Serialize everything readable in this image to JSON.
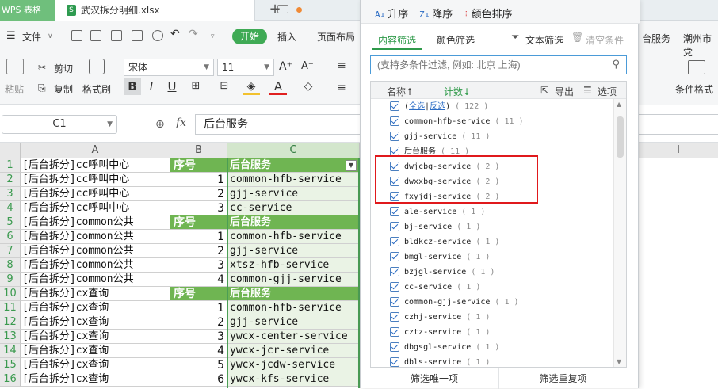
{
  "titlebar": {
    "app_tab": "WPS 表格",
    "file_tab": "武汉拆分明细.xlsx",
    "file_icon": "S",
    "new_tab": "+"
  },
  "menu": {
    "file": "文件",
    "start": "开始",
    "insert": "插入",
    "page_layout": "页面布局",
    "backend": "台服务",
    "chaozhou": "潮州市党"
  },
  "toolbar": {
    "paste": "粘贴",
    "cut": "剪切",
    "copy": "复制",
    "format_painter": "格式刷",
    "font": "宋体",
    "font_size": "11",
    "cond_format": "条件格式"
  },
  "formula_bar": {
    "name_box": "C1",
    "fx": "fx",
    "value": "后台服务"
  },
  "sheet": {
    "col_headers": [
      "A",
      "B",
      "C",
      "I"
    ],
    "rows": [
      {
        "n": "1",
        "a": "[后台拆分]cc呼叫中心",
        "b": "序号",
        "c": "后台服务",
        "hdr": true
      },
      {
        "n": "2",
        "a": "[后台拆分]cc呼叫中心",
        "b": "1",
        "c": "common-hfb-service",
        "hdr": false
      },
      {
        "n": "3",
        "a": "[后台拆分]cc呼叫中心",
        "b": "2",
        "c": "gjj-service",
        "hdr": false
      },
      {
        "n": "4",
        "a": "[后台拆分]cc呼叫中心",
        "b": "3",
        "c": "cc-service",
        "hdr": false
      },
      {
        "n": "5",
        "a": "[后台拆分]common公共",
        "b": "序号",
        "c": "后台服务",
        "hdr": true
      },
      {
        "n": "6",
        "a": "[后台拆分]common公共",
        "b": "1",
        "c": "common-hfb-service",
        "hdr": false
      },
      {
        "n": "7",
        "a": "[后台拆分]common公共",
        "b": "2",
        "c": "gjj-service",
        "hdr": false
      },
      {
        "n": "8",
        "a": "[后台拆分]common公共",
        "b": "3",
        "c": "xtsz-hfb-service",
        "hdr": false
      },
      {
        "n": "9",
        "a": "[后台拆分]common公共",
        "b": "4",
        "c": "common-gjj-service",
        "hdr": false
      },
      {
        "n": "10",
        "a": "[后台拆分]cx查询",
        "b": "序号",
        "c": "后台服务",
        "hdr": true
      },
      {
        "n": "11",
        "a": "[后台拆分]cx查询",
        "b": "1",
        "c": "common-hfb-service",
        "hdr": false
      },
      {
        "n": "12",
        "a": "[后台拆分]cx查询",
        "b": "2",
        "c": "gjj-service",
        "hdr": false
      },
      {
        "n": "13",
        "a": "[后台拆分]cx查询",
        "b": "3",
        "c": "ywcx-center-service",
        "hdr": false
      },
      {
        "n": "14",
        "a": "[后台拆分]cx查询",
        "b": "4",
        "c": "ywcx-jcr-service",
        "hdr": false
      },
      {
        "n": "15",
        "a": "[后台拆分]cx查询",
        "b": "5",
        "c": "ywcx-jcdw-service",
        "hdr": false
      },
      {
        "n": "16",
        "a": "[后台拆分]cx查询",
        "b": "6",
        "c": "ywcx-kfs-service",
        "hdr": false
      }
    ]
  },
  "filter": {
    "sort_asc": "升序",
    "sort_desc": "降序",
    "sort_color": "颜色排序",
    "tab_content": "内容筛选",
    "tab_color": "颜色筛选",
    "text_filter": "文本筛选",
    "clear": "清空条件",
    "search_placeholder": "(支持多条件过滤, 例如: 北京 上海)",
    "col_name": "名称↑",
    "col_count": "计数↓",
    "export": "导出",
    "options": "选项",
    "select_all": "全选",
    "invert": "反选",
    "select_all_count": "( 122 )",
    "items": [
      {
        "name": "common-hfb-service",
        "count": "( 11 )"
      },
      {
        "name": "gjj-service",
        "count": "( 11 )"
      },
      {
        "name": "后台服务",
        "count": "( 11 )"
      },
      {
        "name": "dwjcbg-service",
        "count": "( 2 )"
      },
      {
        "name": "dwxxbg-service",
        "count": "( 2 )"
      },
      {
        "name": "fxyjdj-service",
        "count": "( 2 )"
      },
      {
        "name": "ale-service",
        "count": "( 1 )"
      },
      {
        "name": "bj-service",
        "count": "( 1 )"
      },
      {
        "name": "bldkcz-service",
        "count": "( 1 )"
      },
      {
        "name": "bmgl-service",
        "count": "( 1 )"
      },
      {
        "name": "bzjgl-service",
        "count": "( 1 )"
      },
      {
        "name": "cc-service",
        "count": "( 1 )"
      },
      {
        "name": "common-gjj-service",
        "count": "( 1 )"
      },
      {
        "name": "czhj-service",
        "count": "( 1 )"
      },
      {
        "name": "cztz-service",
        "count": "( 1 )"
      },
      {
        "name": "dbgsgl-service",
        "count": "( 1 )"
      },
      {
        "name": "dbls-service",
        "count": "( 1 )"
      }
    ],
    "btn_unique": "筛选唯一项",
    "btn_duplicate": "筛选重复项"
  }
}
